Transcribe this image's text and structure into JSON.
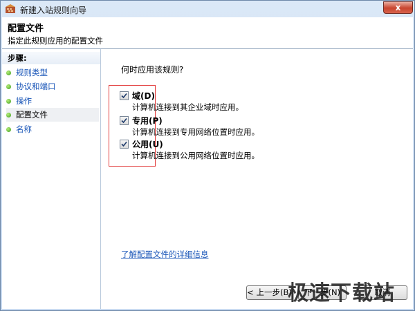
{
  "window": {
    "title": "新建入站规则向导",
    "close_label": "x"
  },
  "header": {
    "title": "配置文件",
    "subtitle": "指定此规则应用的配置文件"
  },
  "sidebar": {
    "heading": "步骤:",
    "items": [
      {
        "label": "规则类型",
        "current": false
      },
      {
        "label": "协议和端口",
        "current": false
      },
      {
        "label": "操作",
        "current": false
      },
      {
        "label": "配置文件",
        "current": true
      },
      {
        "label": "名称",
        "current": false
      }
    ]
  },
  "main": {
    "question": "何时应用该规则?",
    "options": [
      {
        "label": "域(D)",
        "description": "计算机连接到其企业域时应用。",
        "checked": true
      },
      {
        "label": "专用(P)",
        "description": "计算机连接到专用网络位置时应用。",
        "checked": true
      },
      {
        "label": "公用(U)",
        "description": "计算机连接到公用网络位置时应用。",
        "checked": true
      }
    ],
    "learn_more": "了解配置文件的详细信息"
  },
  "buttons": {
    "back": "< 上一步(B)",
    "next": "下一步(N)",
    "cancel": "取消"
  },
  "watermark": "极速下载站",
  "colors": {
    "link": "#1a56b8",
    "highlight": "#e23a3a",
    "step_dot": "#3b9a1c"
  }
}
